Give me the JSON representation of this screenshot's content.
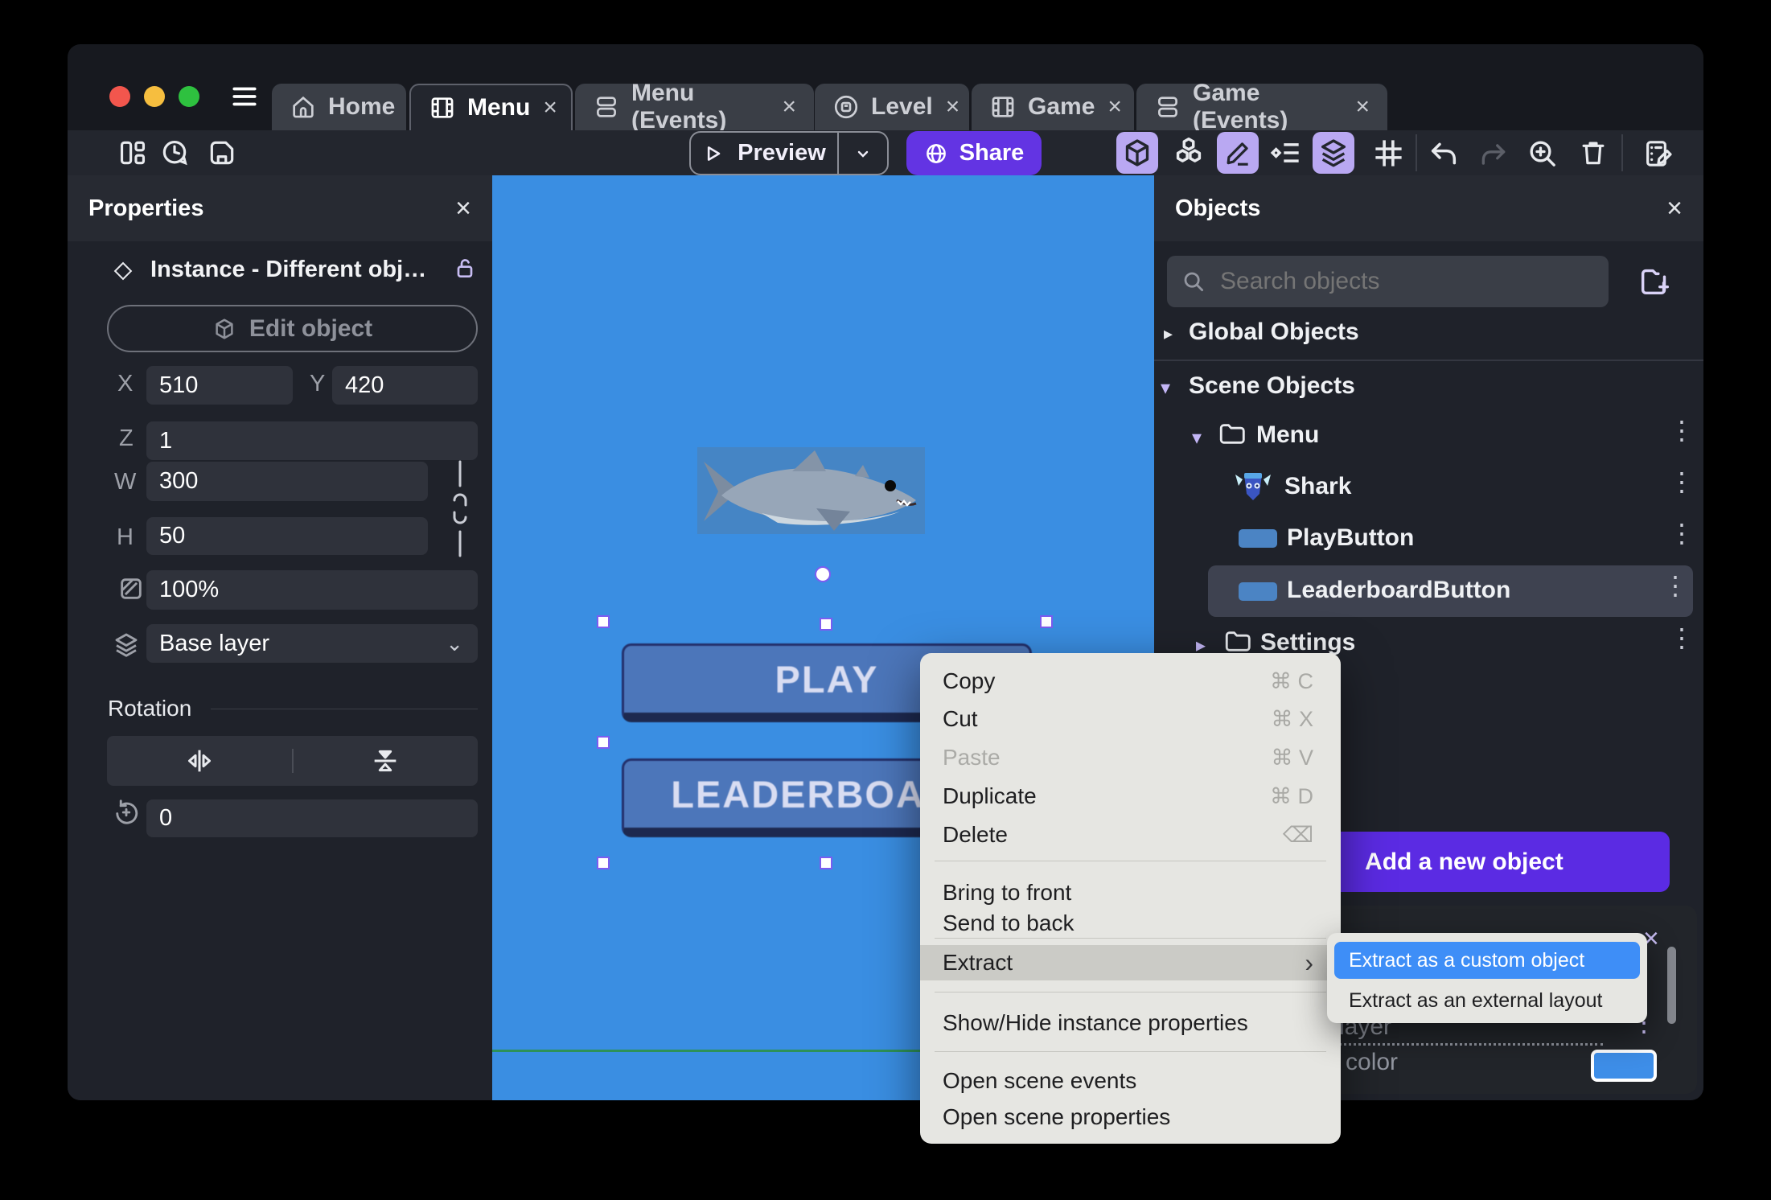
{
  "glyphs": {
    "close": "×",
    "kebab": "⋮",
    "chev_right": "▸",
    "chev_down": "▾",
    "chev_select": "⌄",
    "submenu_arrow": "›",
    "plus": "+"
  },
  "tabs": [
    {
      "label": "Home",
      "icon": "home-icon",
      "active": false,
      "closable": false
    },
    {
      "label": "Menu",
      "icon": "scene-icon",
      "active": true,
      "closable": true
    },
    {
      "label": "Menu (Events)",
      "icon": "events-icon",
      "active": false,
      "closable": true
    },
    {
      "label": "Level",
      "icon": "external-layout-icon",
      "active": false,
      "closable": true
    },
    {
      "label": "Game",
      "icon": "scene-icon",
      "active": false,
      "closable": true
    },
    {
      "label": "Game (Events)",
      "icon": "events-icon",
      "active": false,
      "closable": true
    }
  ],
  "toolbar": {
    "preview": "Preview",
    "share": "Share"
  },
  "properties": {
    "title": "Properties",
    "instance_title": "Instance  -  Different obj…",
    "edit_object": "Edit object",
    "x_label": "X",
    "x_value": "510",
    "y_label": "Y",
    "y_value": "420",
    "z_label": "Z",
    "z_value": "1",
    "w_label": "W",
    "w_value": "300",
    "h_label": "H",
    "h_value": "50",
    "opacity_value": "100%",
    "layer_value": "Base layer",
    "rotation_title": "Rotation",
    "rotation_value": "0"
  },
  "canvas": {
    "play": "PLAY",
    "leaderboard": "LEADERBOARD"
  },
  "objects": {
    "title": "Objects",
    "search_placeholder": "Search objects",
    "global": "Global Objects",
    "scene": "Scene Objects",
    "items": [
      {
        "label": "Menu",
        "type": "folder",
        "expanded": true
      },
      {
        "label": "Shark",
        "type": "sprite"
      },
      {
        "label": "PlayButton",
        "type": "panel-sprite"
      },
      {
        "label": "LeaderboardButton",
        "type": "panel-sprite",
        "selected": true
      },
      {
        "label": "Settings",
        "type": "folder",
        "expanded": false
      }
    ],
    "add_button": "Add a new object",
    "layer_partial": "layer",
    "color_partial": "d color"
  },
  "context_menu": {
    "items": [
      {
        "label": "Copy",
        "shortcut": "⌘ C"
      },
      {
        "label": "Cut",
        "shortcut": "⌘ X"
      },
      {
        "label": "Paste",
        "shortcut": "⌘ V",
        "disabled": true
      },
      {
        "label": "Duplicate",
        "shortcut": "⌘ D"
      },
      {
        "label": "Delete",
        "shortcut": "⌫"
      },
      {
        "label": "Bring to front"
      },
      {
        "label": "Send to back"
      },
      {
        "label": "Extract",
        "highlighted": true,
        "has_submenu": true
      },
      {
        "label": "Show/Hide instance properties"
      },
      {
        "label": "Open scene events"
      },
      {
        "label": "Open scene properties"
      }
    ]
  },
  "submenu": {
    "custom_object": "Extract as a custom object",
    "external_layout": "Extract as an external layout"
  },
  "colors": {
    "accent_purple": "#5B2BE3",
    "share_purple": "#6334E3",
    "toolbar_active_lavender": "#B9A8F2",
    "canvas_blue": "#3A8EE2",
    "game_button_blue": "#4C76BA",
    "selection_purple": "#7C5CF0",
    "submenu_highlight_blue": "#3E8EF7",
    "green_border_line": "#2D9158",
    "swatch_blue": "#3E8EE8"
  }
}
